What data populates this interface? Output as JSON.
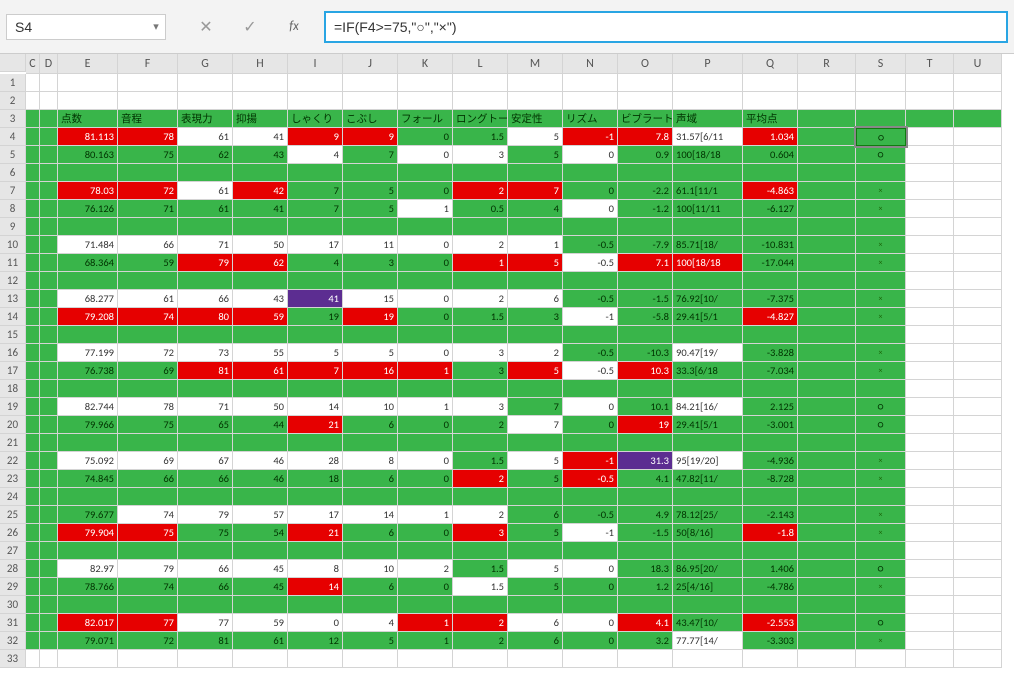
{
  "namebox": "S4",
  "formula": "=IF(F4>=75,\"○\",\"×\")",
  "cols": [
    "C",
    "D",
    "E",
    "F",
    "G",
    "H",
    "I",
    "J",
    "K",
    "L",
    "M",
    "N",
    "O",
    "P",
    "Q",
    "R",
    "S",
    "T",
    "U"
  ],
  "row_start": 1,
  "row_end": 33,
  "headers": [
    "点数",
    "音程",
    "表現力",
    "抑揚",
    "しゃくり",
    "こぶし",
    "フォール",
    "ロングトー",
    "安定性",
    "リズム",
    "ビブラート",
    "声域",
    "平均点"
  ],
  "active_cell": {
    "row": 4,
    "col": "S"
  },
  "rows": [
    {
      "rn": 4,
      "st": "w",
      "cells": [
        [
          "81.113",
          "r"
        ],
        [
          "78",
          "r"
        ],
        [
          "61",
          "w"
        ],
        [
          "41",
          "w"
        ],
        [
          "9",
          "r"
        ],
        [
          "9",
          "r"
        ],
        [
          "0",
          "g"
        ],
        [
          "1.5",
          "g"
        ],
        [
          "5",
          "w"
        ],
        [
          "-1",
          "r"
        ],
        [
          "7.8",
          "r"
        ],
        [
          "31.57[6/11",
          "w"
        ],
        [
          "1.034",
          "r"
        ]
      ],
      "s": "○"
    },
    {
      "rn": 5,
      "st": "w",
      "cells": [
        [
          "80.163",
          "g"
        ],
        [
          "75",
          "g"
        ],
        [
          "62",
          "g"
        ],
        [
          "43",
          "g"
        ],
        [
          "4",
          "w"
        ],
        [
          "7",
          "g"
        ],
        [
          "0",
          "w"
        ],
        [
          "3",
          "w"
        ],
        [
          "5",
          "g"
        ],
        [
          "0",
          "w"
        ],
        [
          "0.9",
          "g"
        ],
        [
          "100[18/18",
          "g"
        ],
        [
          "0.604",
          "g"
        ]
      ],
      "s": "○"
    },
    {
      "rn": 6,
      "blank": true
    },
    {
      "rn": 7,
      "st": "w",
      "cells": [
        [
          "78.03",
          "r"
        ],
        [
          "72",
          "r"
        ],
        [
          "61",
          "w"
        ],
        [
          "42",
          "r"
        ],
        [
          "7",
          "g"
        ],
        [
          "5",
          "g"
        ],
        [
          "0",
          "g"
        ],
        [
          "2",
          "r"
        ],
        [
          "7",
          "r"
        ],
        [
          "0",
          "g"
        ],
        [
          "-2.2",
          "g"
        ],
        [
          "61.1[11/1",
          "g"
        ],
        [
          "-4.863",
          "r"
        ]
      ],
      "s": "×",
      "dimS": true
    },
    {
      "rn": 8,
      "st": "w",
      "cells": [
        [
          "76.126",
          "g"
        ],
        [
          "71",
          "g"
        ],
        [
          "61",
          "g"
        ],
        [
          "41",
          "g"
        ],
        [
          "7",
          "g"
        ],
        [
          "5",
          "g"
        ],
        [
          "1",
          "w"
        ],
        [
          "0.5",
          "g"
        ],
        [
          "4",
          "g"
        ],
        [
          "0",
          "w"
        ],
        [
          "-1.2",
          "g"
        ],
        [
          "100[11/11",
          "g"
        ],
        [
          "-6.127",
          "g"
        ]
      ],
      "s": "×",
      "dimS": true
    },
    {
      "rn": 9,
      "blank": true
    },
    {
      "rn": 10,
      "st": "w",
      "cells": [
        [
          "71.484",
          "w"
        ],
        [
          "66",
          "w"
        ],
        [
          "71",
          "w"
        ],
        [
          "50",
          "w"
        ],
        [
          "17",
          "w"
        ],
        [
          "11",
          "w"
        ],
        [
          "0",
          "w"
        ],
        [
          "2",
          "w"
        ],
        [
          "1",
          "w"
        ],
        [
          "-0.5",
          "g"
        ],
        [
          "-7.9",
          "g"
        ],
        [
          "85.71[18/",
          "g"
        ],
        [
          "-10.831",
          "g"
        ]
      ],
      "s": "×",
      "dimS": true
    },
    {
      "rn": 11,
      "st": "w",
      "cells": [
        [
          "68.364",
          "g"
        ],
        [
          "59",
          "g"
        ],
        [
          "79",
          "r"
        ],
        [
          "62",
          "r"
        ],
        [
          "4",
          "g"
        ],
        [
          "3",
          "g"
        ],
        [
          "0",
          "g"
        ],
        [
          "1",
          "r"
        ],
        [
          "5",
          "r"
        ],
        [
          "-0.5",
          "w"
        ],
        [
          "7.1",
          "r"
        ],
        [
          "100[18/18",
          "r"
        ],
        [
          "-17.044",
          "g"
        ]
      ],
      "s": "×",
      "dimS": true
    },
    {
      "rn": 12,
      "blank": true
    },
    {
      "rn": 13,
      "st": "w",
      "cells": [
        [
          "68.277",
          "w"
        ],
        [
          "61",
          "w"
        ],
        [
          "66",
          "w"
        ],
        [
          "43",
          "w"
        ],
        [
          "41",
          "p"
        ],
        [
          "15",
          "w"
        ],
        [
          "0",
          "w"
        ],
        [
          "2",
          "w"
        ],
        [
          "6",
          "w"
        ],
        [
          "-0.5",
          "g"
        ],
        [
          "-1.5",
          "g"
        ],
        [
          "76.92[10/",
          "g"
        ],
        [
          "-7.375",
          "g"
        ]
      ],
      "s": "×",
      "dimS": true
    },
    {
      "rn": 14,
      "st": "w",
      "cells": [
        [
          "79.208",
          "r"
        ],
        [
          "74",
          "r"
        ],
        [
          "80",
          "r"
        ],
        [
          "59",
          "r"
        ],
        [
          "19",
          "g"
        ],
        [
          "19",
          "r"
        ],
        [
          "0",
          "g"
        ],
        [
          "1.5",
          "g"
        ],
        [
          "3",
          "g"
        ],
        [
          "-1",
          "w"
        ],
        [
          "-5.8",
          "g"
        ],
        [
          "29.41[5/1",
          "g"
        ],
        [
          "-4.827",
          "r"
        ]
      ],
      "s": "×",
      "dimS": true
    },
    {
      "rn": 15,
      "blank": true
    },
    {
      "rn": 16,
      "st": "w",
      "cells": [
        [
          "77.199",
          "w"
        ],
        [
          "72",
          "w"
        ],
        [
          "73",
          "w"
        ],
        [
          "55",
          "w"
        ],
        [
          "5",
          "w"
        ],
        [
          "5",
          "w"
        ],
        [
          "0",
          "w"
        ],
        [
          "3",
          "w"
        ],
        [
          "2",
          "w"
        ],
        [
          "-0.5",
          "g"
        ],
        [
          "-10.3",
          "g"
        ],
        [
          "90.47[19/",
          "w"
        ],
        [
          "-3.828",
          "g"
        ]
      ],
      "s": "×",
      "dimS": true
    },
    {
      "rn": 17,
      "st": "w",
      "cells": [
        [
          "76.738",
          "g"
        ],
        [
          "69",
          "g"
        ],
        [
          "81",
          "r"
        ],
        [
          "61",
          "r"
        ],
        [
          "7",
          "r"
        ],
        [
          "16",
          "r"
        ],
        [
          "1",
          "r"
        ],
        [
          "3",
          "g"
        ],
        [
          "5",
          "r"
        ],
        [
          "-0.5",
          "w"
        ],
        [
          "10.3",
          "r"
        ],
        [
          "33.3[6/18",
          "g"
        ],
        [
          "-7.034",
          "g"
        ]
      ],
      "s": "×",
      "dimS": true
    },
    {
      "rn": 18,
      "blank": true
    },
    {
      "rn": 19,
      "st": "w",
      "cells": [
        [
          "82.744",
          "w"
        ],
        [
          "78",
          "w"
        ],
        [
          "71",
          "w"
        ],
        [
          "50",
          "w"
        ],
        [
          "14",
          "w"
        ],
        [
          "10",
          "w"
        ],
        [
          "1",
          "w"
        ],
        [
          "3",
          "w"
        ],
        [
          "7",
          "g"
        ],
        [
          "0",
          "w"
        ],
        [
          "10.1",
          "g"
        ],
        [
          "84.21[16/",
          "w"
        ],
        [
          "2.125",
          "g"
        ]
      ],
      "s": "○"
    },
    {
      "rn": 20,
      "st": "w",
      "cells": [
        [
          "79.966",
          "g"
        ],
        [
          "75",
          "g"
        ],
        [
          "65",
          "g"
        ],
        [
          "44",
          "g"
        ],
        [
          "21",
          "r"
        ],
        [
          "6",
          "g"
        ],
        [
          "0",
          "g"
        ],
        [
          "2",
          "g"
        ],
        [
          "7",
          "w"
        ],
        [
          "0",
          "g"
        ],
        [
          "19",
          "r"
        ],
        [
          "29.41[5/1",
          "g"
        ],
        [
          "-3.001",
          "g"
        ]
      ],
      "s": "○"
    },
    {
      "rn": 21,
      "blank": true
    },
    {
      "rn": 22,
      "st": "w",
      "cells": [
        [
          "75.092",
          "w"
        ],
        [
          "69",
          "w"
        ],
        [
          "67",
          "w"
        ],
        [
          "46",
          "w"
        ],
        [
          "28",
          "w"
        ],
        [
          "8",
          "w"
        ],
        [
          "0",
          "w"
        ],
        [
          "1.5",
          "g"
        ],
        [
          "5",
          "w"
        ],
        [
          "-1",
          "r"
        ],
        [
          "31.3",
          "p"
        ],
        [
          "95[19/20]",
          "w"
        ],
        [
          "-4.936",
          "g"
        ]
      ],
      "s": "×",
      "dimS": true
    },
    {
      "rn": 23,
      "st": "w",
      "cells": [
        [
          "74.845",
          "g"
        ],
        [
          "66",
          "g"
        ],
        [
          "66",
          "g"
        ],
        [
          "46",
          "g"
        ],
        [
          "18",
          "g"
        ],
        [
          "6",
          "g"
        ],
        [
          "0",
          "g"
        ],
        [
          "2",
          "r"
        ],
        [
          "5",
          "g"
        ],
        [
          "-0.5",
          "r"
        ],
        [
          "4.1",
          "g"
        ],
        [
          "47.82[11/",
          "g"
        ],
        [
          "-8.728",
          "g"
        ]
      ],
      "s": "×",
      "dimS": true
    },
    {
      "rn": 24,
      "blank": true
    },
    {
      "rn": 25,
      "st": "w",
      "cells": [
        [
          "79.677",
          "g"
        ],
        [
          "74",
          "w"
        ],
        [
          "79",
          "w"
        ],
        [
          "57",
          "w"
        ],
        [
          "17",
          "w"
        ],
        [
          "14",
          "w"
        ],
        [
          "1",
          "w"
        ],
        [
          "2",
          "w"
        ],
        [
          "6",
          "g"
        ],
        [
          "-0.5",
          "g"
        ],
        [
          "4.9",
          "g"
        ],
        [
          "78.12[25/",
          "g"
        ],
        [
          "-2.143",
          "g"
        ]
      ],
      "s": "×",
      "dimS": true
    },
    {
      "rn": 26,
      "st": "w",
      "cells": [
        [
          "79.904",
          "r"
        ],
        [
          "75",
          "r"
        ],
        [
          "75",
          "g"
        ],
        [
          "54",
          "g"
        ],
        [
          "21",
          "r"
        ],
        [
          "6",
          "g"
        ],
        [
          "0",
          "g"
        ],
        [
          "3",
          "r"
        ],
        [
          "5",
          "g"
        ],
        [
          "-1",
          "w"
        ],
        [
          "-1.5",
          "g"
        ],
        [
          "50[8/16]",
          "g"
        ],
        [
          "-1.8",
          "r"
        ]
      ],
      "s": "×",
      "dimS": true
    },
    {
      "rn": 27,
      "blank": true
    },
    {
      "rn": 28,
      "st": "w",
      "cells": [
        [
          "82.97",
          "w"
        ],
        [
          "79",
          "w"
        ],
        [
          "66",
          "w"
        ],
        [
          "45",
          "w"
        ],
        [
          "8",
          "w"
        ],
        [
          "10",
          "w"
        ],
        [
          "2",
          "w"
        ],
        [
          "1.5",
          "g"
        ],
        [
          "5",
          "w"
        ],
        [
          "0",
          "w"
        ],
        [
          "18.3",
          "g"
        ],
        [
          "86.95[20/",
          "g"
        ],
        [
          "1.406",
          "g"
        ]
      ],
      "s": "○"
    },
    {
      "rn": 29,
      "st": "w",
      "cells": [
        [
          "78.766",
          "g"
        ],
        [
          "74",
          "g"
        ],
        [
          "66",
          "g"
        ],
        [
          "45",
          "g"
        ],
        [
          "14",
          "r"
        ],
        [
          "6",
          "g"
        ],
        [
          "0",
          "g"
        ],
        [
          "1.5",
          "w"
        ],
        [
          "5",
          "g"
        ],
        [
          "0",
          "g"
        ],
        [
          "1.2",
          "g"
        ],
        [
          "25[4/16]",
          "g"
        ],
        [
          "-4.786",
          "g"
        ]
      ],
      "s": "×",
      "dimS": true
    },
    {
      "rn": 30,
      "blank": true
    },
    {
      "rn": 31,
      "st": "w",
      "cells": [
        [
          "82.017",
          "r"
        ],
        [
          "77",
          "r"
        ],
        [
          "77",
          "w"
        ],
        [
          "59",
          "w"
        ],
        [
          "0",
          "w"
        ],
        [
          "4",
          "w"
        ],
        [
          "1",
          "r"
        ],
        [
          "2",
          "r"
        ],
        [
          "6",
          "w"
        ],
        [
          "0",
          "w"
        ],
        [
          "4.1",
          "r"
        ],
        [
          "43.47[10/",
          "g"
        ],
        [
          "-2.553",
          "r"
        ]
      ],
      "s": "○"
    },
    {
      "rn": 32,
      "st": "w",
      "cells": [
        [
          "79.071",
          "g"
        ],
        [
          "72",
          "g"
        ],
        [
          "81",
          "g"
        ],
        [
          "61",
          "g"
        ],
        [
          "12",
          "g"
        ],
        [
          "5",
          "g"
        ],
        [
          "1",
          "g"
        ],
        [
          "2",
          "g"
        ],
        [
          "6",
          "g"
        ],
        [
          "0",
          "g"
        ],
        [
          "3.2",
          "g"
        ],
        [
          "77.77[14/",
          "w"
        ],
        [
          "-3.303",
          "g"
        ]
      ],
      "s": "×",
      "dimS": true
    }
  ]
}
